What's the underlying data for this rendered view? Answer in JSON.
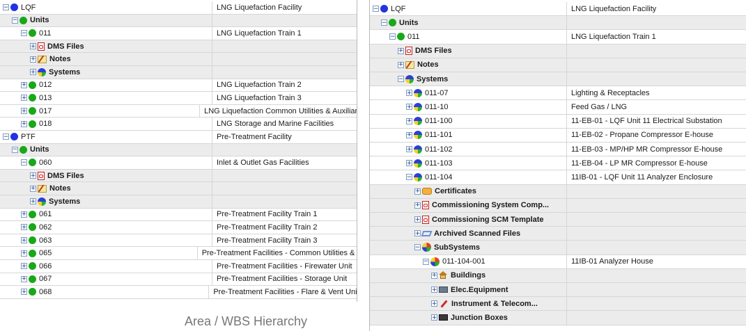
{
  "left_panel": {
    "rows": [
      {
        "level": 0,
        "expander": "−",
        "icon": "blue-circle",
        "label": "LQF",
        "bold": false,
        "desc": "LNG Liquefaction Facility"
      },
      {
        "level": 1,
        "expander": "−",
        "icon": "green-circle",
        "label": "Units",
        "bold": true,
        "desc": ""
      },
      {
        "level": 2,
        "expander": "−",
        "icon": "green-circle",
        "label": "011",
        "bold": false,
        "desc": "LNG Liquefaction Train 1"
      },
      {
        "level": 3,
        "expander": "+",
        "icon": "pdf",
        "label": "DMS Files",
        "bold": true,
        "desc": ""
      },
      {
        "level": 3,
        "expander": "+",
        "icon": "note",
        "label": "Notes",
        "bold": true,
        "desc": ""
      },
      {
        "level": 3,
        "expander": "+",
        "icon": "multi-circle",
        "label": "Systems",
        "bold": true,
        "desc": ""
      },
      {
        "level": 2,
        "expander": "+",
        "icon": "green-circle",
        "label": "012",
        "bold": false,
        "desc": "LNG Liquefaction Train 2"
      },
      {
        "level": 2,
        "expander": "+",
        "icon": "green-circle",
        "label": "013",
        "bold": false,
        "desc": "LNG Liquefaction Train 3"
      },
      {
        "level": 2,
        "expander": "+",
        "icon": "green-circle",
        "label": "017",
        "bold": false,
        "desc": "LNG Liquefaction Common Utilities & Auxiliaries"
      },
      {
        "level": 2,
        "expander": "+",
        "icon": "green-circle",
        "label": "018",
        "bold": false,
        "desc": "LNG Storage and Marine Facilities"
      },
      {
        "level": 0,
        "expander": "−",
        "icon": "blue-circle",
        "label": "PTF",
        "bold": false,
        "desc": "Pre-Treatment Facility"
      },
      {
        "level": 1,
        "expander": "−",
        "icon": "green-circle",
        "label": "Units",
        "bold": true,
        "desc": ""
      },
      {
        "level": 2,
        "expander": "−",
        "icon": "green-circle",
        "label": "060",
        "bold": false,
        "desc": "Inlet & Outlet Gas Facilities"
      },
      {
        "level": 3,
        "expander": "+",
        "icon": "pdf",
        "label": "DMS Files",
        "bold": true,
        "desc": ""
      },
      {
        "level": 3,
        "expander": "+",
        "icon": "note",
        "label": "Notes",
        "bold": true,
        "desc": ""
      },
      {
        "level": 3,
        "expander": "+",
        "icon": "multi-circle",
        "label": "Systems",
        "bold": true,
        "desc": ""
      },
      {
        "level": 2,
        "expander": "+",
        "icon": "green-circle",
        "label": "061",
        "bold": false,
        "desc": "Pre-Treatment Facility Train 1"
      },
      {
        "level": 2,
        "expander": "+",
        "icon": "green-circle",
        "label": "062",
        "bold": false,
        "desc": "Pre-Treatment Facility Train 2"
      },
      {
        "level": 2,
        "expander": "+",
        "icon": "green-circle",
        "label": "063",
        "bold": false,
        "desc": "Pre-Treatment Facility Train 3"
      },
      {
        "level": 2,
        "expander": "+",
        "icon": "green-circle",
        "label": "065",
        "bold": false,
        "desc": "Pre-Treatment Facilities - Common Utilities & Aux"
      },
      {
        "level": 2,
        "expander": "+",
        "icon": "green-circle",
        "label": "066",
        "bold": false,
        "desc": "Pre-Treatment Facilities - Firewater Unit"
      },
      {
        "level": 2,
        "expander": "+",
        "icon": "green-circle",
        "label": "067",
        "bold": false,
        "desc": "Pre-Treatment Facilities - Storage Unit"
      },
      {
        "level": 2,
        "expander": "+",
        "icon": "green-circle",
        "label": "068",
        "bold": false,
        "desc": "Pre-Treatment Facilities - Flare & Vent Unit"
      }
    ]
  },
  "right_panel": {
    "rows": [
      {
        "level": 0,
        "expander": "−",
        "icon": "blue-circle",
        "label": "LQF",
        "bold": false,
        "desc": "LNG Liquefaction Facility"
      },
      {
        "level": 1,
        "expander": "−",
        "icon": "green-circle",
        "label": "Units",
        "bold": true,
        "desc": ""
      },
      {
        "level": 2,
        "expander": "−",
        "icon": "green-circle",
        "label": "011",
        "bold": false,
        "desc": "LNG Liquefaction Train 1"
      },
      {
        "level": 3,
        "expander": "+",
        "icon": "pdf",
        "label": "DMS Files",
        "bold": true,
        "desc": ""
      },
      {
        "level": 3,
        "expander": "+",
        "icon": "note",
        "label": "Notes",
        "bold": true,
        "desc": ""
      },
      {
        "level": 3,
        "expander": "−",
        "icon": "multi-circle",
        "label": "Systems",
        "bold": true,
        "desc": ""
      },
      {
        "level": 4,
        "expander": "+",
        "icon": "multi-circle",
        "label": "011-07",
        "bold": false,
        "desc": "Lighting & Receptacles"
      },
      {
        "level": 4,
        "expander": "+",
        "icon": "multi-circle",
        "label": "011-10",
        "bold": false,
        "desc": "Feed Gas / LNG"
      },
      {
        "level": 4,
        "expander": "+",
        "icon": "multi-circle",
        "label": "011-100",
        "bold": false,
        "desc": "11-EB-01 - LQF Unit 11 Electrical Substation"
      },
      {
        "level": 4,
        "expander": "+",
        "icon": "multi-circle",
        "label": "011-101",
        "bold": false,
        "desc": "11-EB-02 - Propane Compressor E-house"
      },
      {
        "level": 4,
        "expander": "+",
        "icon": "multi-circle",
        "label": "011-102",
        "bold": false,
        "desc": "11-EB-03 - MP/HP MR Compressor E-house"
      },
      {
        "level": 4,
        "expander": "+",
        "icon": "multi-circle",
        "label": "011-103",
        "bold": false,
        "desc": "11-EB-04 - LP MR Compressor E-house"
      },
      {
        "level": 4,
        "expander": "−",
        "icon": "multi-circle",
        "label": "011-104",
        "bold": false,
        "desc": "11IB-01 - LQF Unit 11 Analyzer Enclosure"
      },
      {
        "level": 5,
        "expander": "+",
        "icon": "cert",
        "label": "Certificates",
        "bold": true,
        "desc": ""
      },
      {
        "level": 5,
        "expander": "+",
        "icon": "pdf",
        "label": "Commissioning System Comp...",
        "bold": true,
        "desc": ""
      },
      {
        "level": 5,
        "expander": "+",
        "icon": "pdf",
        "label": "Commissioning SCM Template",
        "bold": true,
        "desc": ""
      },
      {
        "level": 5,
        "expander": "+",
        "icon": "archive",
        "label": "Archived Scanned Files",
        "bold": true,
        "desc": ""
      },
      {
        "level": 5,
        "expander": "−",
        "icon": "subsystem",
        "label": "SubSystems",
        "bold": true,
        "desc": ""
      },
      {
        "level": 6,
        "expander": "−",
        "icon": "subsystem",
        "label": "011-104-001",
        "bold": false,
        "desc": "11IB-01 Analyzer House"
      },
      {
        "level": 7,
        "expander": "+",
        "icon": "building",
        "label": "Buildings",
        "bold": true,
        "desc": ""
      },
      {
        "level": 7,
        "expander": "+",
        "icon": "elec",
        "label": "Elec.Equipment",
        "bold": true,
        "desc": ""
      },
      {
        "level": 7,
        "expander": "+",
        "icon": "instrument",
        "label": "Instrument & Telecom...",
        "bold": true,
        "desc": ""
      },
      {
        "level": 7,
        "expander": "+",
        "icon": "junction",
        "label": "Junction Boxes",
        "bold": true,
        "desc": ""
      }
    ]
  },
  "caption": "Area / WBS Hierarchy",
  "colors": {
    "row_alt": "#ececec",
    "grid_line": "#d6d6d6",
    "blue_node": "#2233e0",
    "green_node": "#18a818",
    "caption_text": "#777777"
  }
}
